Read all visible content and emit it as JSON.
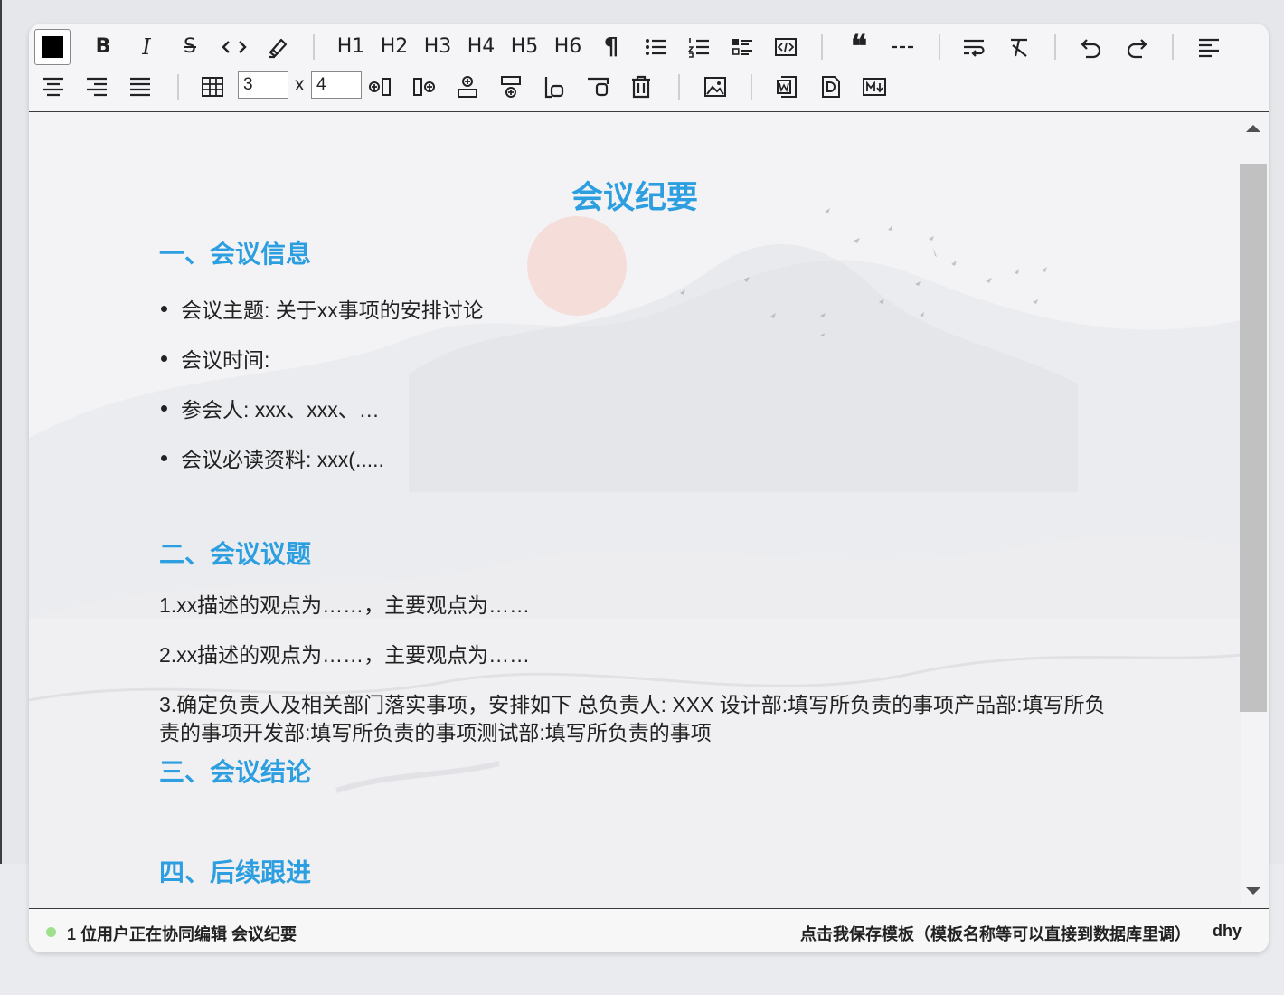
{
  "toolbar": {
    "row1": [
      {
        "name": "text-color-button",
        "icon": "color-swatch"
      },
      {
        "name": "bold-button",
        "label": "B"
      },
      {
        "name": "italic-button",
        "label": "I"
      },
      {
        "name": "strikethrough-button",
        "label": "S"
      },
      {
        "name": "inline-code-button",
        "label": "‹ ›"
      },
      {
        "name": "highlight-button",
        "icon": "marker-icon"
      },
      {
        "name": "h1-button",
        "label": "H1"
      },
      {
        "name": "h2-button",
        "label": "H2"
      },
      {
        "name": "h3-button",
        "label": "H3"
      },
      {
        "name": "h4-button",
        "label": "H4"
      },
      {
        "name": "h5-button",
        "label": "H5"
      },
      {
        "name": "h6-button",
        "label": "H6"
      },
      {
        "name": "paragraph-button",
        "label": "¶"
      },
      {
        "name": "bullet-list-button",
        "icon": "bullet-list-icon"
      },
      {
        "name": "ordered-list-button",
        "icon": "ordered-list-icon"
      },
      {
        "name": "task-list-button",
        "icon": "task-list-icon"
      },
      {
        "name": "code-block-button",
        "icon": "code-block-icon"
      },
      {
        "name": "blockquote-button",
        "label": "❝"
      },
      {
        "name": "horizontal-rule-button",
        "icon": "horizontal-rule-icon"
      },
      {
        "name": "hard-break-button",
        "icon": "text-wrap-icon"
      },
      {
        "name": "clear-format-button",
        "icon": "clear-format-icon"
      },
      {
        "name": "undo-button",
        "icon": "undo-icon"
      },
      {
        "name": "redo-button",
        "icon": "redo-icon"
      },
      {
        "name": "align-left-button",
        "icon": "align-left-icon"
      }
    ],
    "table_rows": "3",
    "table_cols": "4",
    "times_label": "x"
  },
  "document": {
    "title": "会议纪要",
    "section1": {
      "heading": "一、会议信息",
      "items": [
        "会议主题: 关于xx事项的安排讨论",
        "会议时间:",
        "参会人: xxx、xxx、…",
        "会议必读资料: xxx(....."
      ]
    },
    "section2": {
      "heading": "二、会议议题",
      "paragraphs": [
        "1.xx描述的观点为……，主要观点为……",
        "2.xx描述的观点为……，主要观点为……",
        "3.确定负责人及相关部门落实事项，安排如下 总负责人: XXX 设计部:填写所负责的事项产品部:填写所负责的事项开发部:填写所负责的事项测试部:填写所负责的事项"
      ]
    },
    "section3": {
      "heading": "三、会议结论"
    },
    "section4": {
      "heading": "四、后续跟进"
    }
  },
  "status": {
    "collab_text": "1 位用户正在协同编辑 会议纪要",
    "save_link": "点击我保存模板（模板名称等可以直接到数据库里调）",
    "user": "dhy",
    "online_color": "#9fe08a"
  },
  "colors": {
    "heading": "#2d9fe0",
    "text": "#222222"
  }
}
